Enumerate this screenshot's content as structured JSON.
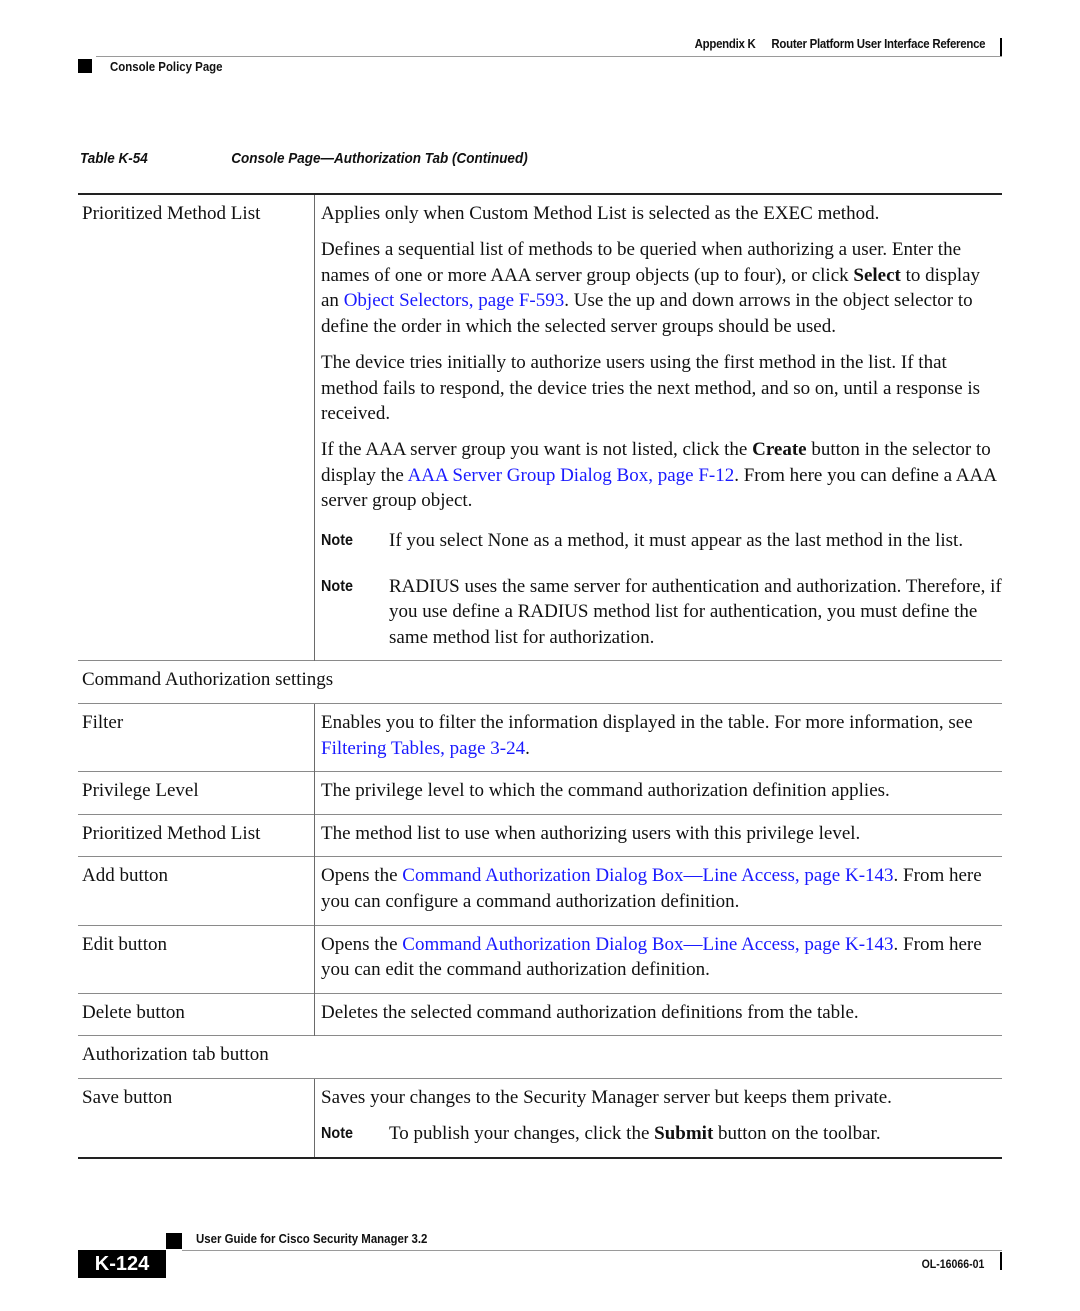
{
  "header": {
    "appendix": "Appendix K",
    "chapter_title": "Router Platform User Interface Reference",
    "section": "Console Policy Page"
  },
  "table": {
    "number": "Table K-54",
    "title": "Console Page—Authorization Tab (Continued)",
    "prioritized_method_list": {
      "label": "Prioritized Method List",
      "p1": "Applies only when Custom Method List is selected as the EXEC method.",
      "p2_a": "Defines a sequential list of methods to be queried when authorizing a user. Enter the names of one or more AAA server group objects (up to four), or click ",
      "p2_bold": "Select",
      "p2_b": " to display an ",
      "p2_link": "Object Selectors, page F-593",
      "p2_c": ". Use the up and down arrows in the object selector to define the order in which the selected server groups should be used.",
      "p3": "The device tries initially to authorize users using the first method in the list. If that method fails to respond, the device tries the next method, and so on, until a response is received.",
      "p4_a": "If the AAA server group you want is not listed, click the ",
      "p4_bold": "Create",
      "p4_b": " button in the selector to display the ",
      "p4_link": "AAA Server Group Dialog Box, page F-12",
      "p4_c": ". From here you can define a AAA server group object.",
      "note_label": "Note",
      "note1": "If you select None as a method, it must appear as the last method in the list.",
      "note2": "RADIUS uses the same server for authentication and authorization. Therefore, if you use define a RADIUS method list for authentication, you must define the same method list for authorization."
    },
    "section_command_auth": "Command Authorization settings",
    "filter": {
      "label": "Filter",
      "text_a": "Enables you to filter the information displayed in the table. For more information, see ",
      "link": "Filtering Tables, page 3-24",
      "text_b": "."
    },
    "privilege_level": {
      "label": "Privilege Level",
      "text": "The privilege level to which the command authorization definition applies."
    },
    "cmd_method_list": {
      "label": "Prioritized Method List",
      "text": "The method list to use when authorizing users with this privilege level."
    },
    "add_button": {
      "label": "Add button",
      "text_a": "Opens the ",
      "link": "Command Authorization Dialog Box—Line Access, page K-143",
      "text_b": ". From here you can configure a command authorization definition."
    },
    "edit_button": {
      "label": "Edit button",
      "text_a": "Opens the ",
      "link": "Command Authorization Dialog Box—Line Access, page K-143",
      "text_b": ". From here you can edit the command authorization definition."
    },
    "delete_button": {
      "label": "Delete button",
      "text": "Deletes the selected command authorization definitions from the table."
    },
    "section_tab_button": "Authorization tab button",
    "save_button": {
      "label": "Save button",
      "text": "Saves your changes to the Security Manager server but keeps them private.",
      "note_label": "Note",
      "note_a": "To publish your changes, click the ",
      "note_bold": "Submit",
      "note_b": " button on the toolbar."
    }
  },
  "footer": {
    "guide_title": "User Guide for Cisco Security Manager 3.2",
    "page_number": "K-124",
    "doc_number": "OL-16066-01"
  },
  "colors": {
    "link": "#1a1aff",
    "text": "#111111",
    "rule": "#8a8a8a"
  }
}
